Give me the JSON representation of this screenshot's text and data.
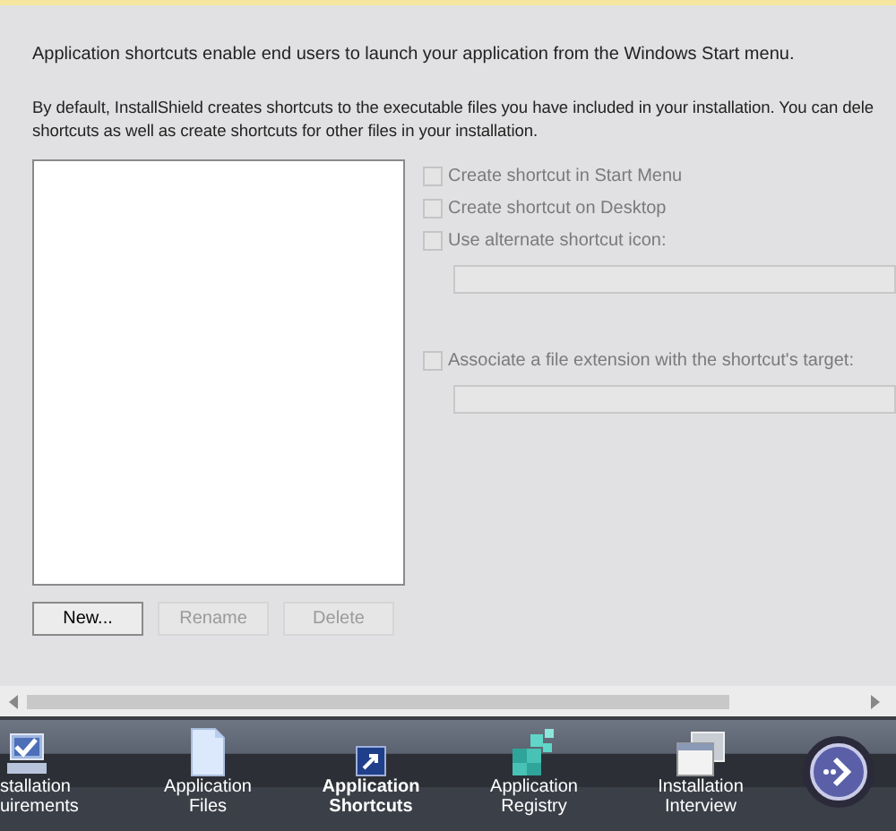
{
  "intro": "Application shortcuts enable end users to launch your application from the Windows Start menu.",
  "description": [
    "By default, InstallShield creates shortcuts to the executable files you have included in your installation. You can dele",
    "shortcuts as well as create shortcuts for other files in your installation."
  ],
  "options": [
    {
      "kind": "checkbox",
      "label": "Create shortcut in Start Menu",
      "checked": false,
      "disabled": true
    },
    {
      "kind": "checkbox",
      "label": "Create shortcut on Desktop",
      "checked": false,
      "disabled": true
    },
    {
      "kind": "checkbox",
      "label": "Use alternate shortcut icon:",
      "checked": false,
      "disabled": true
    },
    {
      "kind": "field",
      "disabled": true
    },
    {
      "kind": "checkbox",
      "label": "Associate a file extension with the shortcut's target:",
      "checked": false,
      "disabled": true
    },
    {
      "kind": "field",
      "disabled": true
    }
  ],
  "buttons": [
    {
      "label": "New...",
      "disabled": false
    },
    {
      "label": "Rename",
      "disabled": true
    },
    {
      "label": "Delete",
      "disabled": true
    }
  ],
  "nav": [
    {
      "kind": "computer",
      "label": "stallation uirements",
      "selected": false
    },
    {
      "kind": "document",
      "label": "Application Files",
      "selected": false
    },
    {
      "kind": "shortcut",
      "label": "Application Shortcuts",
      "selected": true
    },
    {
      "kind": "registry",
      "label": "Application Registry",
      "selected": false
    },
    {
      "kind": "dialog",
      "label": "Installation Interview",
      "selected": false
    }
  ]
}
